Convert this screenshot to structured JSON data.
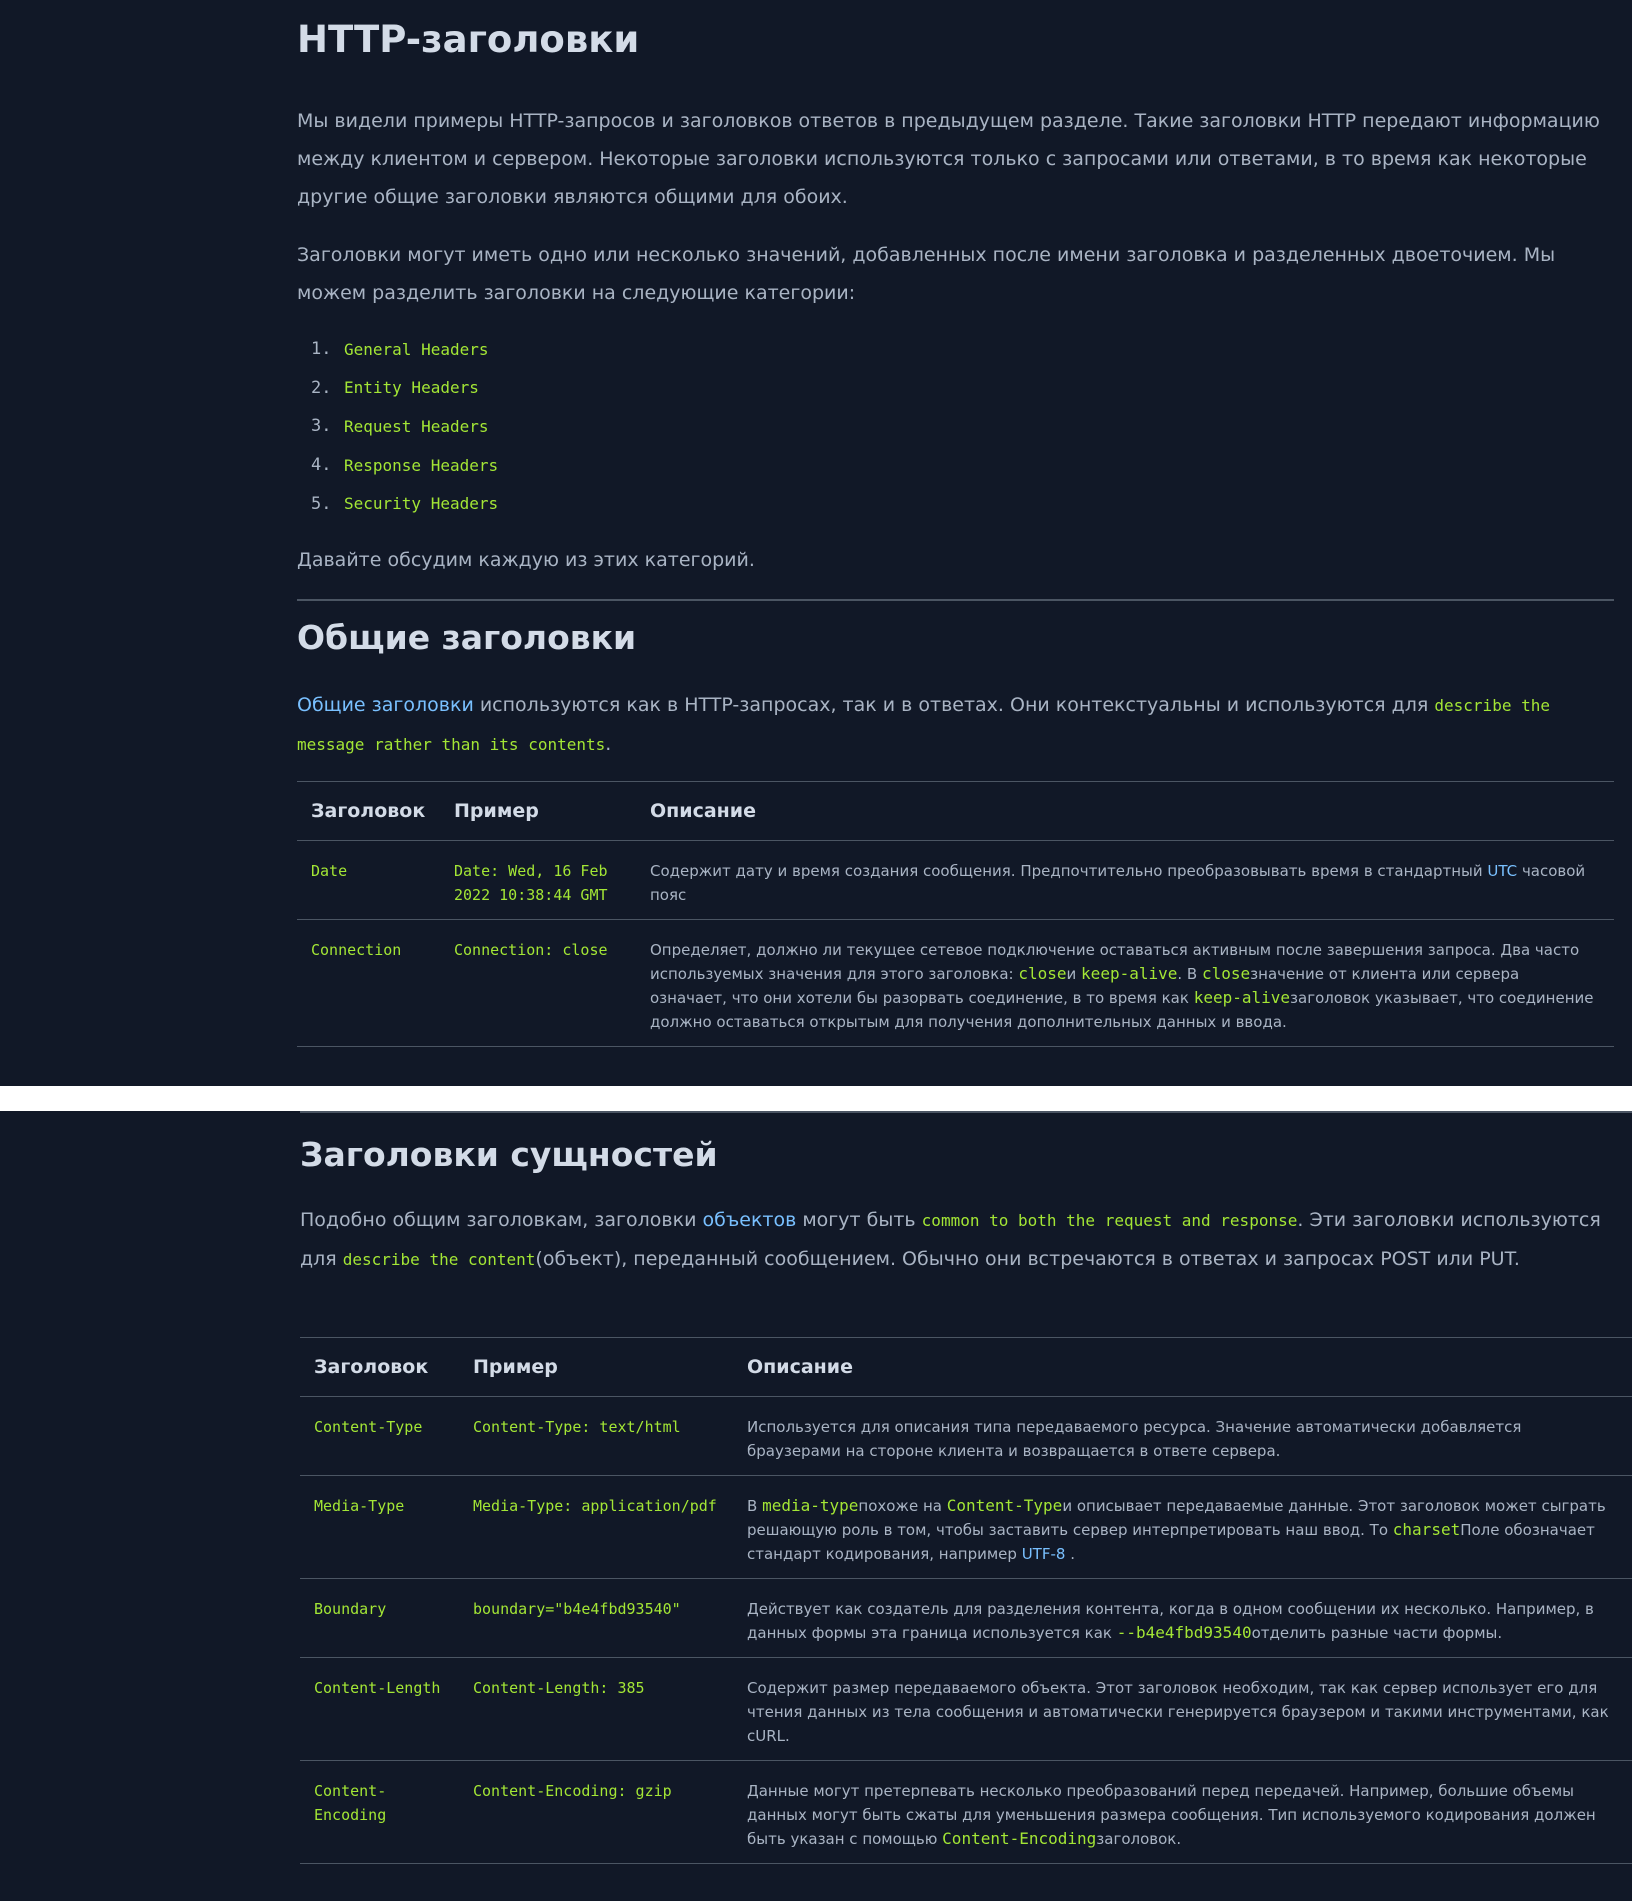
{
  "section1": {
    "title": "HTTP-заголовки",
    "intro1": "Мы видели примеры HTTP-запросов и заголовков ответов в предыдущем разделе. Такие заголовки HTTP передают информацию между клиентом и сервером. Некоторые заголовки используются только с запросами или ответами, в то время как некоторые другие общие заголовки являются общими для обоих.",
    "intro2": "Заголовки могут иметь одно или несколько значений, добавленных после имени заголовка и разделенных двоеточием. Мы можем разделить заголовки на следующие категории:",
    "categories": [
      {
        "num": "1.",
        "label": "General Headers"
      },
      {
        "num": "2.",
        "label": "Entity Headers"
      },
      {
        "num": "3.",
        "label": "Request Headers"
      },
      {
        "num": "4.",
        "label": "Response Headers"
      },
      {
        "num": "5.",
        "label": "Security Headers"
      }
    ],
    "outro": "Давайте обсудим каждую из этих категорий."
  },
  "general": {
    "title": "Общие заголовки",
    "link": "Общие заголовки",
    "text1": " используются как в HTTP-запросах, так и в ответах. Они контекстуальны и используются для ",
    "code1": "describe the message rather than its contents",
    "text2": ".",
    "table": {
      "headers": [
        "Заголовок",
        "Пример",
        "Описание"
      ],
      "rows": [
        {
          "name": "Date",
          "example": "Date: Wed, 16 Feb 2022 10:38:44 GMT",
          "desc_a": "Содержит дату и время создания сообщения. Предпочтительно преобразовывать время в стандартный ",
          "desc_link": "UTC",
          "desc_b": " часовой пояс"
        },
        {
          "name": "Connection",
          "example": "Connection: close",
          "desc_a": "Определяет, должно ли текущее сетевое подключение оставаться активным после завершения запроса. Два часто используемых значения для этого заголовка: ",
          "code_a": "close",
          "desc_b": "и ",
          "code_b": "keep-alive",
          "desc_c": ". В ",
          "code_c": "close",
          "desc_d": "значение от клиента или сервера означает, что они хотели бы разорвать соединение, в то время как ",
          "code_d": "keep-alive",
          "desc_e": "заголовок указывает, что соединение должно оставаться открытым для получения дополнительных данных и ввода."
        }
      ]
    }
  },
  "entity": {
    "title": "Заголовки сущностей",
    "text1": "Подобно общим заголовкам, заголовки ",
    "link": "объектов",
    "text2": " могут быть ",
    "code1": "common to both the request and response",
    "text3": ". Эти заголовки используются для ",
    "code2": "describe the content",
    "text4": "(объект), переданный сообщением. Обычно они встречаются в ответах и запросах POST или PUT.",
    "table": {
      "headers": [
        "Заголовок",
        "Пример",
        "Описание"
      ],
      "rows": [
        {
          "name": "Content-Type",
          "example": "Content-Type: text/html",
          "desc_a": "Используется для описания типа передаваемого ресурса. Значение автоматически добавляется браузерами на стороне клиента и возвращается в ответе сервера."
        },
        {
          "name": "Media-Type",
          "example": "Media-Type: application/pdf",
          "desc_a": "В ",
          "code_a": "media-type",
          "desc_b": "похоже на ",
          "code_b": "Content-Type",
          "desc_c": "и описывает передаваемые данные. Этот заголовок может сыграть решающую роль в том, чтобы заставить сервер интерпретировать наш ввод. То ",
          "code_c": "charset",
          "desc_d": "Поле обозначает стандарт кодирования, например ",
          "link": "UTF-8",
          "desc_e": " ."
        },
        {
          "name": "Boundary",
          "example": "boundary=\"b4e4fbd93540\"",
          "desc_a": "Действует как создатель для разделения контента, когда в одном сообщении их несколько. Например, в данных формы эта граница используется как ",
          "code_a": "--b4e4fbd93540",
          "desc_b": "отделить разные части формы."
        },
        {
          "name": "Content-Length",
          "example": "Content-Length: 385",
          "desc_a": "Содержит размер передаваемого объекта. Этот заголовок необходим, так как сервер использует его для чтения данных из тела сообщения и автоматически генерируется браузером и такими инструментами, как cURL."
        },
        {
          "name": "Content-Encoding",
          "example": "Content-Encoding: gzip",
          "desc_a": "Данные могут претерпевать несколько преобразований перед передачей. Например, большие объемы данных могут быть сжаты для уменьшения размера сообщения. Тип используемого кодирования должен быть указан с помощью ",
          "code_a": "Content-Encoding",
          "desc_b": "заголовок."
        }
      ]
    }
  }
}
